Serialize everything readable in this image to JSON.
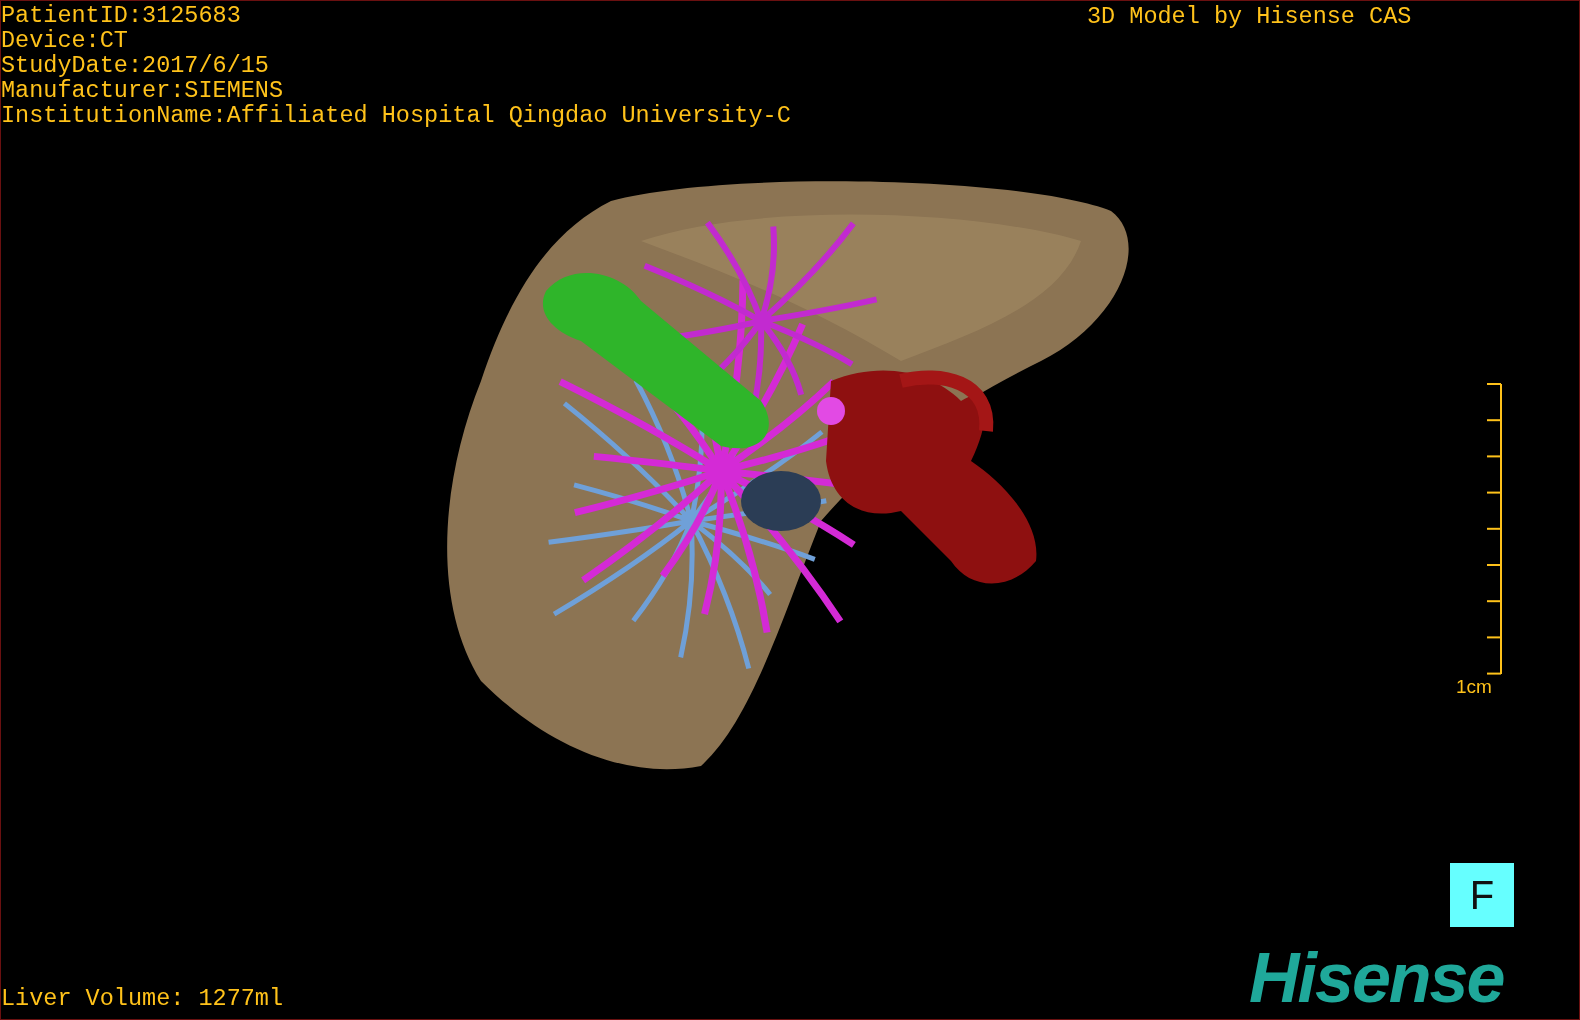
{
  "patient_info": [
    "PatientID:3125683",
    "Device:CT",
    "StudyDate:2017/6/15",
    "Manufacturer:SIEMENS",
    "InstitutionName:Affiliated Hospital Qingdao University-C"
  ],
  "title": "3D Model by Hisense CAS",
  "scale_bar": {
    "label": "1cm"
  },
  "orientation_marker": "F",
  "liver_volume": "Liver Volume: 1277ml",
  "logo": "Hisense"
}
